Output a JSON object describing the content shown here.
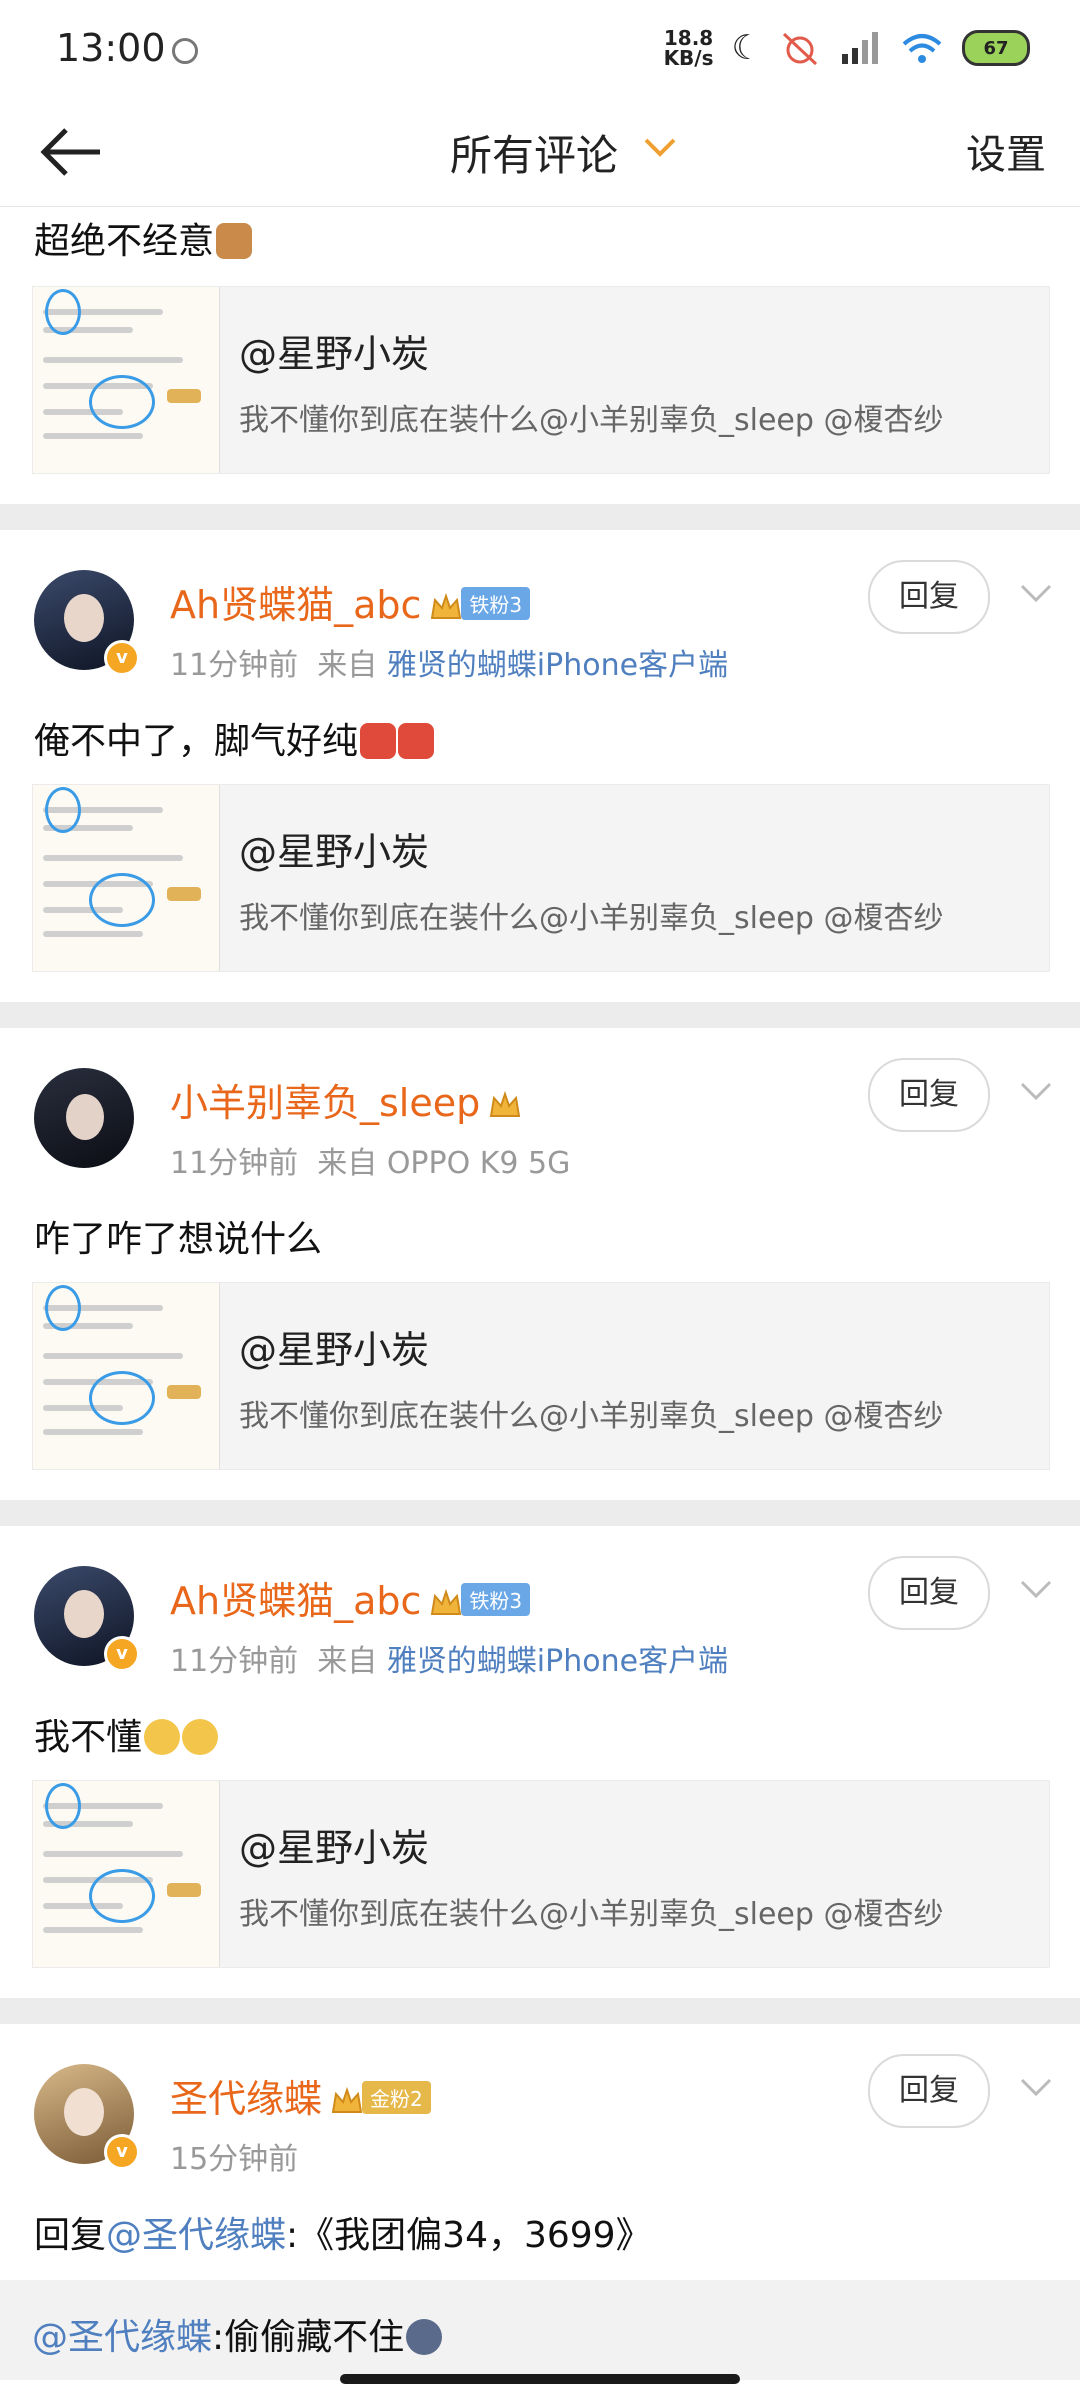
{
  "status_bar": {
    "time": "13:00",
    "speed_value": "18.8",
    "speed_unit": "KB/s",
    "battery": "67"
  },
  "header": {
    "title": "所有评论",
    "settings": "设置"
  },
  "first_item": {
    "text": "超绝不经意",
    "quote": {
      "name": "@星野小炭",
      "text": "我不懂你到底在装什么@小羊别辜负_sleep @榎杏纱"
    }
  },
  "comments": [
    {
      "username": "Ah贤蝶猫_abc",
      "badge": "铁粉3",
      "time": "11分钟前",
      "from_label": "来自",
      "source": "雅贤的蝴蝶iPhone客户端",
      "text": "俺不中了，脚气好纯",
      "reply_label": "回复",
      "quote": {
        "name": "@星野小炭",
        "text": "我不懂你到底在装什么@小羊别辜负_sleep @榎杏纱"
      }
    },
    {
      "username": "小羊别辜负_sleep",
      "time": "11分钟前",
      "from_label": "来自",
      "source": "OPPO K9 5G",
      "text": "咋了咋了想说什么",
      "reply_label": "回复",
      "quote": {
        "name": "@星野小炭",
        "text": "我不懂你到底在装什么@小羊别辜负_sleep @榎杏纱"
      }
    },
    {
      "username": "Ah贤蝶猫_abc",
      "badge": "铁粉3",
      "time": "11分钟前",
      "from_label": "来自",
      "source": "雅贤的蝴蝶iPhone客户端",
      "text": "我不懂",
      "reply_label": "回复",
      "quote": {
        "name": "@星野小炭",
        "text": "我不懂你到底在装什么@小羊别辜负_sleep @榎杏纱"
      }
    },
    {
      "username": "圣代缘蝶",
      "badge": "金粉2",
      "time": "15分钟前",
      "text_prefix": "回复",
      "text_mention": "@圣代缘蝶",
      "text_rest": ":《我团偏34，3699》",
      "reply_label": "回复"
    }
  ],
  "sub_reply": {
    "mention": "@圣代缘蝶",
    "text": ":偷偷藏不住"
  },
  "colors": {
    "username": "#e8671a",
    "link": "#4f7fbf",
    "iron_badge": "#6aa7e6",
    "gold_badge": "#e6b84a"
  }
}
